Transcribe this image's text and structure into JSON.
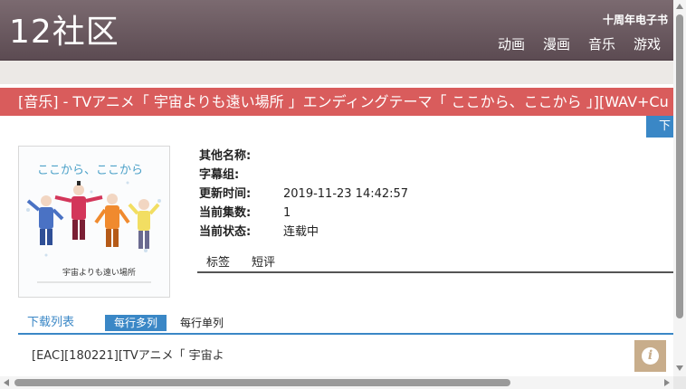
{
  "site": {
    "logo": "12社区",
    "anniversary": "十周年电子书",
    "nav": [
      "动画",
      "漫画",
      "音乐",
      "游戏"
    ]
  },
  "page": {
    "title": "[音乐] - TVアニメ「 宇宙よりも遠い場所 」エンディングテーマ「 ここから、ここから 」][WAV+Cu",
    "download_button": "下载"
  },
  "cover": {
    "title_text": "ここから、ここから",
    "subtitle_text": "宇宙よりも遠い場所"
  },
  "info": {
    "rows": [
      {
        "label": "其他名称:",
        "value": ""
      },
      {
        "label": "字幕组:",
        "value": ""
      },
      {
        "label": "更新时间:",
        "value": "2019-11-23 14:42:57"
      },
      {
        "label": "当前集数:",
        "value": "1"
      },
      {
        "label": "当前状态:",
        "value": "连载中"
      }
    ]
  },
  "tabs": [
    "标签",
    "短评"
  ],
  "downloads": {
    "header": "下载列表",
    "mode_multi": "每行多列",
    "mode_single": "每行单列",
    "files": [
      "[EAC][180221][TVアニメ「 宇宙よ"
    ]
  },
  "info_button": "i",
  "colors": {
    "header": "#6b5a60",
    "title_bar": "#d95c5c",
    "accent": "#3a87c6",
    "info_button": "#c8ad8b"
  }
}
